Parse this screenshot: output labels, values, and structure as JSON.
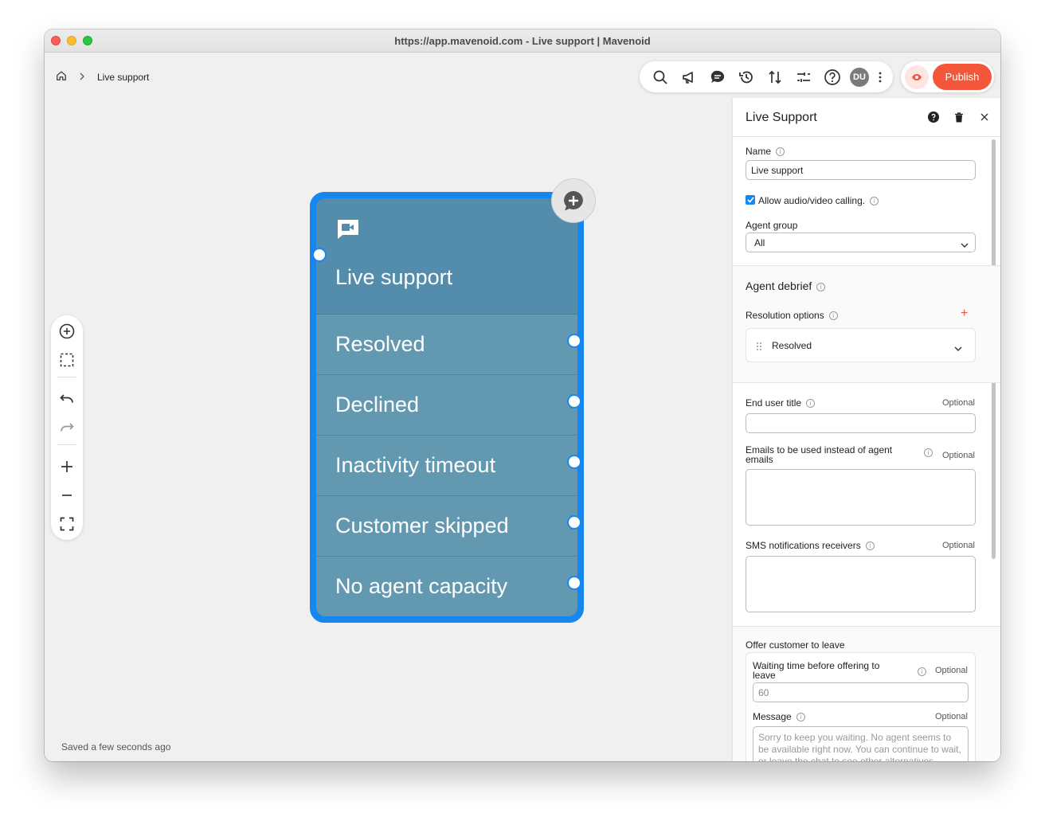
{
  "window": {
    "title": "https://app.mavenoid.com - Live support | Mavenoid"
  },
  "breadcrumb": {
    "home_icon": "home-icon",
    "separator_icon": "chevron-right-icon",
    "current": "Live support"
  },
  "toolbar": {
    "icons": [
      "search-icon",
      "megaphone-icon",
      "chat-icon",
      "history-icon",
      "sort-arrows-icon",
      "sliders-icon",
      "help-icon"
    ],
    "avatar_initials": "DU",
    "more_icon": "more-vertical-icon",
    "preview_icon": "eye-icon",
    "publish_label": "Publish"
  },
  "left_tools": [
    "add-node-icon",
    "select-area-icon",
    "undo-icon",
    "redo-icon",
    "zoom-in-icon",
    "zoom-out-icon",
    "fit-screen-icon"
  ],
  "status": {
    "saved_text": "Saved a few seconds ago"
  },
  "node": {
    "icon": "video-chat-icon",
    "title": "Live support",
    "outcomes": [
      "Resolved",
      "Declined",
      "Inactivity timeout",
      "Customer skipped",
      "No agent capacity"
    ]
  },
  "panel": {
    "title": "Live Support",
    "name_label": "Name",
    "name_value": "Live support",
    "allow_av_label": "Allow audio/video calling.",
    "allow_av_checked": true,
    "agent_group_label": "Agent group",
    "agent_group_value": "All",
    "agent_debrief_title": "Agent debrief",
    "resolution_options_label": "Resolution options",
    "resolution_option": "Resolved",
    "end_user_title_label": "End user title",
    "emails_label": "Emails to be used instead of agent emails",
    "sms_label": "SMS notifications receivers",
    "optional_label": "Optional",
    "offer_leave_title": "Offer customer to leave",
    "waiting_time_label": "Waiting time before offering to leave",
    "waiting_time_placeholder": "60",
    "message_label": "Message",
    "message_placeholder": "Sorry to keep you waiting. No agent seems to be available right now. You can continue to wait, or leave the chat to see other alternatives."
  },
  "colors": {
    "accent": "#1787ef",
    "publish": "#f4563a",
    "node_header": "#548dab",
    "node_row": "#6399b0"
  }
}
